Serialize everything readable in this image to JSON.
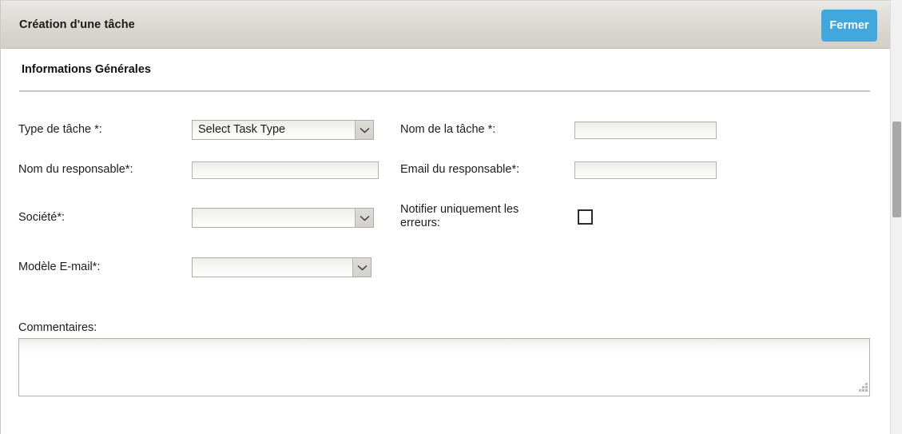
{
  "window": {
    "title": "Création d'une tâche",
    "close_label": "Fermer",
    "accent_color": "#41a7dc",
    "titlebar_color": "#d7d4cc"
  },
  "section": {
    "heading": "Informations Générales"
  },
  "form": {
    "fields": [
      {
        "name": "task-type",
        "label": "Type de tâche *:",
        "control": "select",
        "value": "Select Task Type",
        "placeholder": ""
      },
      {
        "name": "task-name",
        "label": "Nom de la tâche *:",
        "control": "text",
        "value": "",
        "placeholder": ""
      },
      {
        "name": "manager-name",
        "label": "Nom du responsable*:",
        "control": "text",
        "value": "",
        "placeholder": ""
      },
      {
        "name": "manager-email",
        "label": "Email du responsable*:",
        "control": "text",
        "value": "",
        "placeholder": ""
      },
      {
        "name": "company",
        "label": "Société*:",
        "control": "select",
        "value": "",
        "placeholder": ""
      },
      {
        "name": "notify-errors-only",
        "label": "Notifier uniquement les erreurs:",
        "label_line1": "Notifier uniquement les",
        "label_line2": "erreurs:",
        "control": "checkbox",
        "checked": false
      },
      {
        "name": "email-template",
        "label": "Modèle E-mail*:",
        "control": "select",
        "value": "",
        "placeholder": ""
      }
    ],
    "comments": {
      "label": "Commentaires:",
      "value": "",
      "placeholder": ""
    }
  },
  "icons": {
    "chevron_down": "chevron-down-icon",
    "resize_grip": "resize-grip-icon"
  },
  "scrollbar": {
    "orientation": "vertical",
    "thumb_color": "#a8a8a8"
  }
}
